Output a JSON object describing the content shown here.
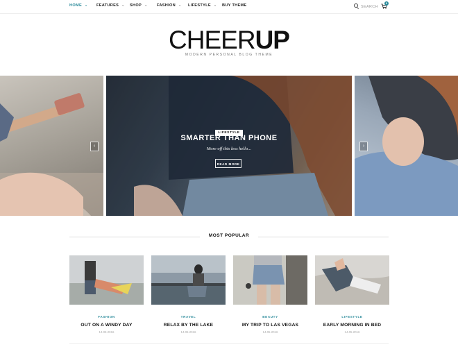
{
  "nav": {
    "items": [
      {
        "label": "HOME",
        "active": true,
        "has_dropdown": true
      },
      {
        "label": "FEATURES",
        "active": false,
        "has_dropdown": true
      },
      {
        "label": "SHOP",
        "active": false,
        "has_dropdown": true
      },
      {
        "label": "FASHION",
        "active": false,
        "has_dropdown": true
      },
      {
        "label": "LIFESTYLE",
        "active": false,
        "has_dropdown": true
      },
      {
        "label": "BUY THEME",
        "active": false,
        "has_dropdown": false
      }
    ],
    "search_placeholder": "SEARCH",
    "cart_count": "0",
    "accent_color": "#2a8a9a"
  },
  "header": {
    "logo_light": "CHEER",
    "logo_bold": "UP",
    "tagline": "MODERN PERSONAL BLOG THEME"
  },
  "slider": {
    "category": "LIFESTYLE",
    "title": "SMARTER THAN PHONE",
    "subtitle": "More off this less hello...",
    "button_label": "READ MORE",
    "prev_icon": "‹",
    "next_icon": "›"
  },
  "popular": {
    "heading": "MOST POPULAR",
    "posts": [
      {
        "category": "FASHION",
        "title": "OUT ON A WINDY DAY",
        "date": "14.05.2016"
      },
      {
        "category": "TRAVEL",
        "title": "RELAX BY THE LAKE",
        "date": "14.05.2016"
      },
      {
        "category": "BEAUTY",
        "title": "MY TRIP TO LAS VEGAS",
        "date": "14.05.2016"
      },
      {
        "category": "LIFESTYLE",
        "title": "EARLY MORNING IN BED",
        "date": "14.05.2016"
      }
    ]
  }
}
